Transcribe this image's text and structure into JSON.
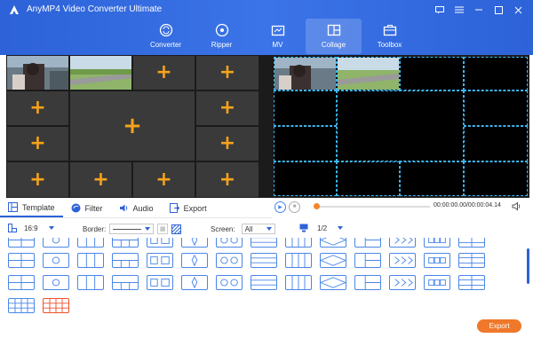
{
  "app": {
    "title": "AnyMP4 Video Converter Ultimate"
  },
  "nav": {
    "items": [
      {
        "label": "Converter",
        "icon": "converter-icon"
      },
      {
        "label": "Ripper",
        "icon": "ripper-icon"
      },
      {
        "label": "MV",
        "icon": "mv-icon"
      },
      {
        "label": "Collage",
        "icon": "collage-icon",
        "active": true
      },
      {
        "label": "Toolbox",
        "icon": "toolbox-icon"
      }
    ]
  },
  "tabs": [
    {
      "label": "Template",
      "icon": "template-icon",
      "active": true
    },
    {
      "label": "Filter",
      "icon": "filter-icon"
    },
    {
      "label": "Audio",
      "icon": "audio-icon"
    },
    {
      "label": "Export",
      "icon": "export-icon"
    }
  ],
  "player": {
    "time": "00:00:00.00/00:00:04.14",
    "progress": 0.0
  },
  "options": {
    "ratio": "16:9",
    "border_label": "Border:",
    "screen_label": "Screen:",
    "screen_value": "All",
    "page": "1/2"
  },
  "export_button": "Export",
  "colors": {
    "brand": "#2d62d8",
    "accent": "#f0782a",
    "plus": "#f5a31a",
    "selected_template": "#f0502a"
  }
}
